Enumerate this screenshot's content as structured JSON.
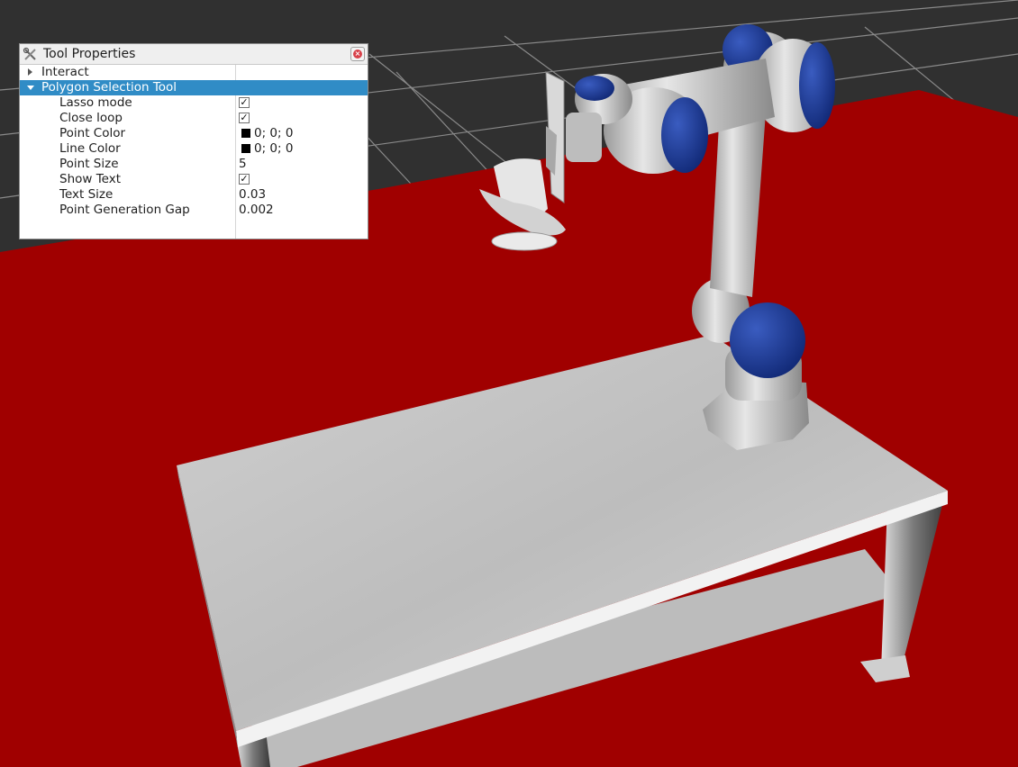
{
  "window": {
    "title": "Tool Properties",
    "close_icon": "close-icon"
  },
  "tree": {
    "items": [
      {
        "name": "Interact",
        "expanded": false
      },
      {
        "name": "Polygon Selection Tool",
        "expanded": true,
        "selected": true
      }
    ],
    "properties": [
      {
        "name": "Lasso mode",
        "type": "checkbox",
        "checked": true
      },
      {
        "name": "Close loop",
        "type": "checkbox",
        "checked": true
      },
      {
        "name": "Point Color",
        "type": "color",
        "value": "0; 0; 0",
        "swatch": "#000000"
      },
      {
        "name": "Line Color",
        "type": "color",
        "value": "0; 0; 0",
        "swatch": "#000000"
      },
      {
        "name": "Point Size",
        "type": "text",
        "value": "5"
      },
      {
        "name": "Show Text",
        "type": "checkbox",
        "checked": true
      },
      {
        "name": "Text Size",
        "type": "text",
        "value": "0.03"
      },
      {
        "name": "Point Generation Gap",
        "type": "text",
        "value": "0.002"
      }
    ]
  },
  "scene": {
    "background_color": "#303030",
    "grid_color": "#8a8a8a",
    "floor_color": "#a00000",
    "table_color": "#c4c4c4",
    "robot_color": "#c8c8c8",
    "joint_color": "#1f3f9e"
  }
}
